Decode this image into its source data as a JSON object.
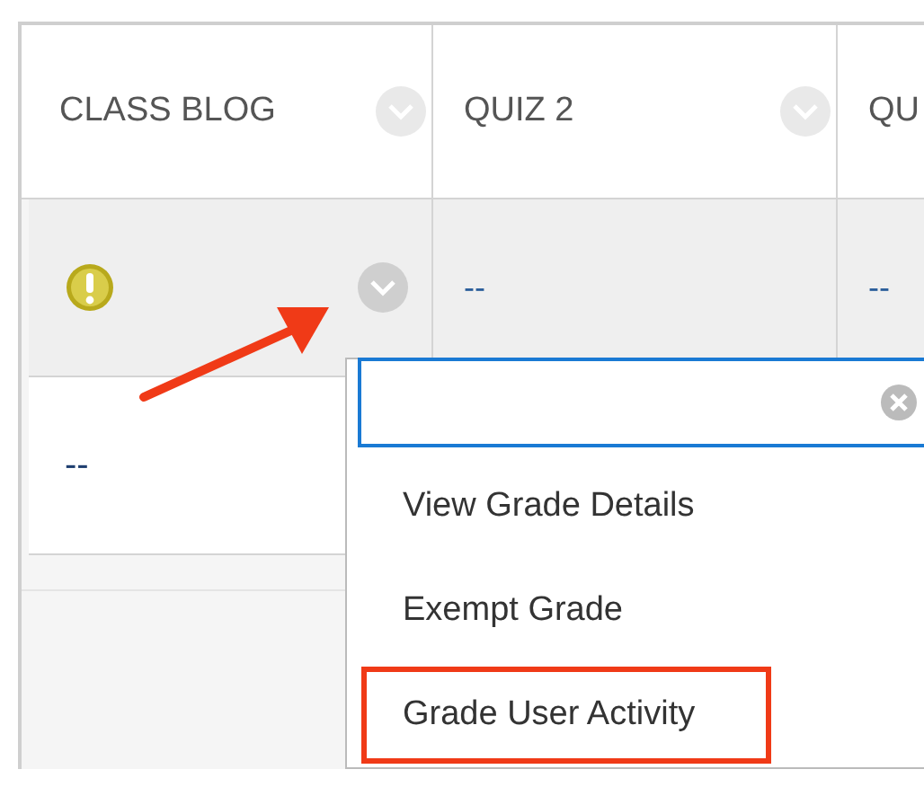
{
  "table": {
    "columns": [
      {
        "label": "CLASS BLOG"
      },
      {
        "label": "QUIZ 2"
      },
      {
        "label": "QU"
      }
    ],
    "rows": [
      {
        "selected": true,
        "cells": [
          {
            "kind": "warning"
          },
          {
            "kind": "text",
            "text": "--"
          },
          {
            "kind": "text",
            "text": "--"
          }
        ]
      },
      {
        "selected": false,
        "cells": [
          {
            "kind": "text",
            "text": "--"
          }
        ]
      }
    ]
  },
  "menu": {
    "items": [
      {
        "label": "View Grade Details",
        "highlighted": false
      },
      {
        "label": "Exempt Grade",
        "highlighted": false
      },
      {
        "label": "Grade User Activity",
        "highlighted": true
      }
    ]
  }
}
